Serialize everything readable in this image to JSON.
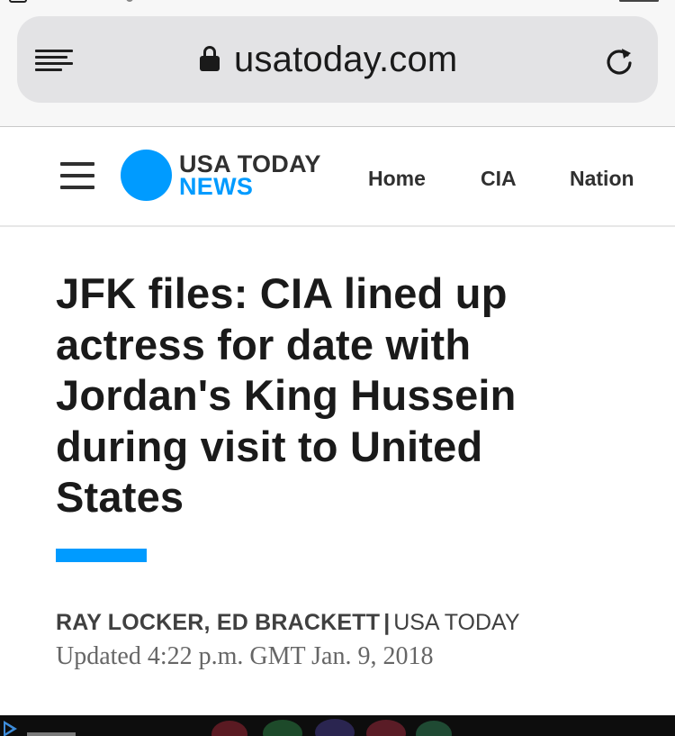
{
  "browser": {
    "url": "usatoday.com"
  },
  "header": {
    "logo_line1": "USA TODAY",
    "logo_line2": "NEWS",
    "nav": [
      {
        "label": "Home"
      },
      {
        "label": "CIA"
      },
      {
        "label": "Nation"
      }
    ]
  },
  "article": {
    "headline_lines": [
      "JFK files: CIA lined up",
      "actress for date with",
      "Jordan's King Hussein",
      "during visit to United",
      "States"
    ],
    "authors": "RAY LOCKER, ED BRACKETT",
    "separator": "|",
    "outlet": "USA TODAY",
    "updated": "Updated 4:22 p.m. GMT Jan. 9, 2018"
  },
  "colors": {
    "brand_blue": "#009bff",
    "text_dark": "#1a1a1a",
    "text_muted": "#666666"
  },
  "icons": [
    "reader-icon",
    "lock-icon",
    "reload-icon",
    "hamburger-icon",
    "play-icon"
  ]
}
